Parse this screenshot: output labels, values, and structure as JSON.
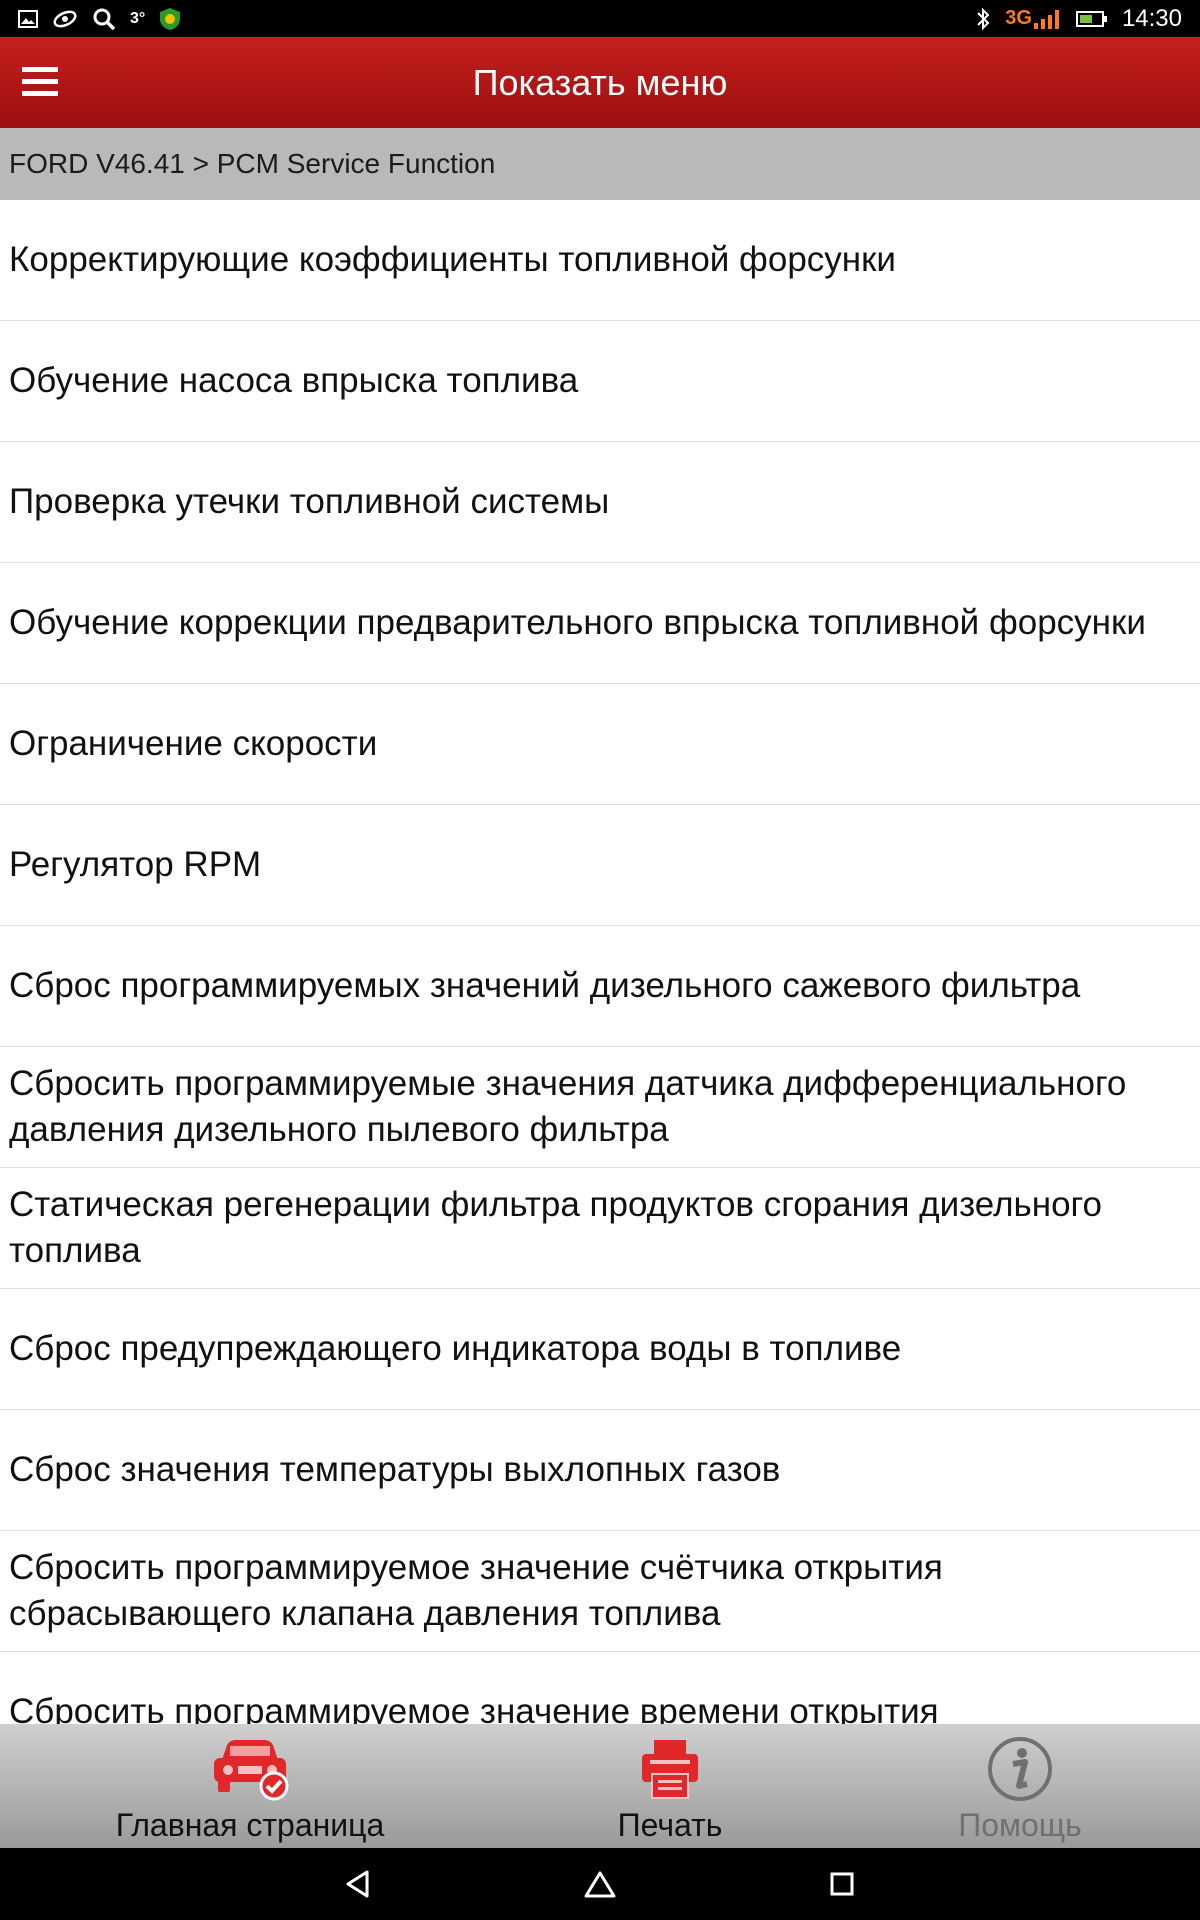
{
  "status_bar": {
    "left_icons": [
      "gallery-icon",
      "sync-icon",
      "search-icon",
      "temperature-indicator",
      "security-app-icon"
    ],
    "temperature": "3°",
    "network": "3G",
    "network_sub": "3G",
    "right_icons": [
      "bluetooth-icon",
      "signal-icon",
      "battery-icon"
    ],
    "time": "14:30"
  },
  "header": {
    "menu_icon": "hamburger-icon",
    "title": "Показать меню",
    "background": "#b01515"
  },
  "breadcrumb": "FORD V46.41 > PCM Service Function",
  "menu_items": [
    "Корректирующие коэффициенты топливной форсунки",
    "Обучение насоса впрыска топлива",
    "Проверка утечки топливной системы",
    "Обучение коррекции предварительного впрыска топливной форсунки",
    "Ограничение скорости",
    "Регулятор RPM",
    "Сброс программируемых значений дизельного сажевого фильтра",
    "Сбросить программируемые значения датчика дифференциального давления дизельного пылевого фильтра",
    "Статическая регенерации фильтра продуктов сгорания дизельного топлива",
    "Сброс предупреждающего индикатора воды в топливе",
    "Сброс значения температуры выхлопных газов",
    "Сбросить программируемое значение счётчика открытия сбрасывающего клапана давления топлива",
    "Сбросить программируемое значение времени открытия"
  ],
  "bottom_nav": {
    "home": {
      "label": "Главная страница",
      "icon": "car-check-icon",
      "color": "#e0282b"
    },
    "print": {
      "label": "Печать",
      "icon": "printer-icon",
      "color": "#e0282b"
    },
    "help": {
      "label": "Помощь",
      "icon": "info-icon",
      "color": "#707070",
      "enabled": false
    }
  },
  "system_nav": [
    "back-icon",
    "home-icon",
    "recents-icon"
  ]
}
